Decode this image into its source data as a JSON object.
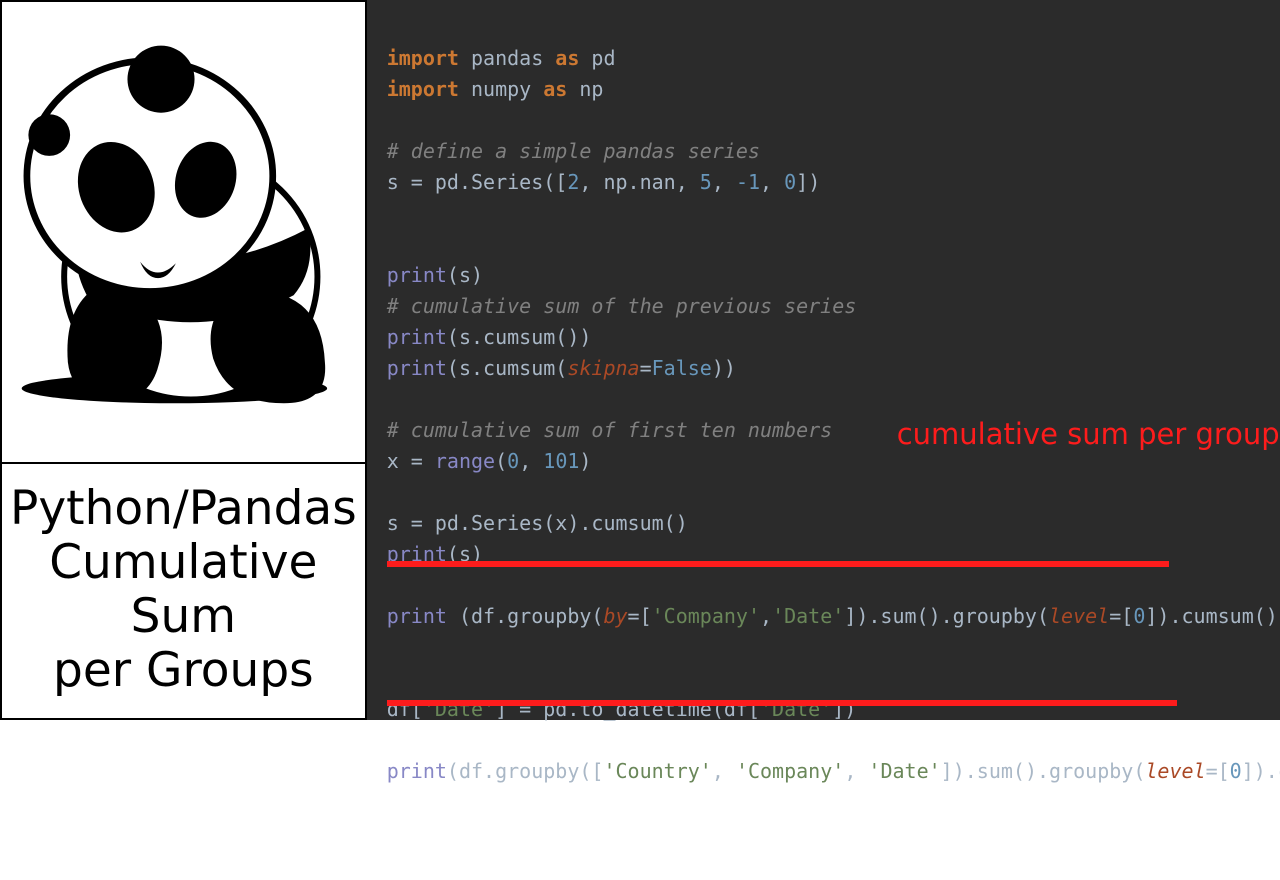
{
  "title": {
    "line1": "Python/Pandas",
    "line2": "Cumulative Sum",
    "line3": "per Groups"
  },
  "annotation": "cumulative sum per groups",
  "code": {
    "l01_a": "import",
    "l01_b": " pandas ",
    "l01_c": "as",
    "l01_d": " pd",
    "l02_a": "import",
    "l02_b": " numpy ",
    "l02_c": "as",
    "l02_d": " np",
    "l04": "# define a simple pandas series",
    "l05_a": "s = pd.Series([",
    "l05_b1": "2",
    "l05_c": ", np.nan, ",
    "l05_b2": "5",
    "l05_d": ", ",
    "l05_b3": "-1",
    "l05_e": ", ",
    "l05_b4": "0",
    "l05_f": "])",
    "l08_a": "print",
    "l08_b": "(s)",
    "l09": "# cumulative sum of the previous series",
    "l10_a": "print",
    "l10_b": "(s.cumsum())",
    "l11_a": "print",
    "l11_b": "(s.cumsum(",
    "l11_p": "skipna",
    "l11_c": "=",
    "l11_v": "False",
    "l11_d": "))",
    "l13": "# cumulative sum of first ten numbers",
    "l14_a": "x = ",
    "l14_fn": "range",
    "l14_b": "(",
    "l14_n1": "0",
    "l14_c": ", ",
    "l14_n2": "101",
    "l14_d": ")",
    "l16": "s = pd.Series(x).cumsum()",
    "l17_a": "print",
    "l17_b": "(s)",
    "l19_a": "print ",
    "l19_b": "(df.groupby(",
    "l19_p1": "by",
    "l19_c": "=[",
    "l19_s1": "'Company'",
    "l19_d": ",",
    "l19_s2": "'Date'",
    "l19_e": "]).sum().groupby(",
    "l19_p2": "level",
    "l19_f": "=[",
    "l19_n": "0",
    "l19_g": "]).cumsum())",
    "l22_a": "df[",
    "l22_s1": "'Date'",
    "l22_b": "] = pd.to_datetime(df[",
    "l22_s2": "'Date'",
    "l22_c": "])",
    "l24_a": "print",
    "l24_b": "(df.groupby([",
    "l24_s1": "'Country'",
    "l24_c": ", ",
    "l24_s2": "'Company'",
    "l24_d": ", ",
    "l24_s3": "'Date'",
    "l24_e": "]).sum().groupby(",
    "l24_p": "level",
    "l24_f": "=[",
    "l24_n": "0",
    "l24_g": "]).cumsum())"
  }
}
